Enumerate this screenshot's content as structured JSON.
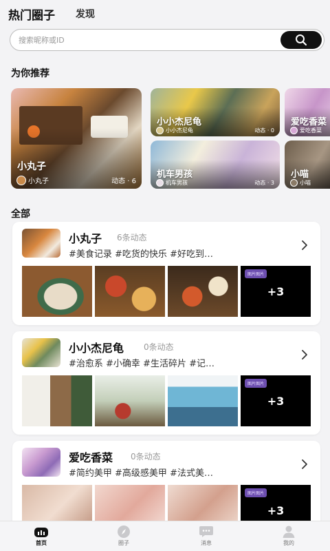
{
  "header": {
    "tab_active": "热门圈子",
    "tab_discover": "发现"
  },
  "search": {
    "placeholder": "搜索昵称或ID"
  },
  "recommend": {
    "title": "为你推荐",
    "cards": [
      {
        "name": "小丸子",
        "author": "小丸子",
        "count": "动态 · 6"
      },
      {
        "name": "小小杰尼龟",
        "author": "小小杰尼龟",
        "count": "动态 · 0"
      },
      {
        "name": "机车男孩",
        "author": "机车男孩",
        "count": "动态 · 3"
      },
      {
        "name": "爱吃香菜",
        "author": "爱吃香菜"
      },
      {
        "name": "小喵",
        "author": "小喵"
      }
    ]
  },
  "all": {
    "title": "全部",
    "circles": [
      {
        "name": "小丸子",
        "count": "6条动态",
        "tags": "#美食记录 #吃货的快乐 #好吃到…",
        "more": "+3",
        "badge": "图片图片"
      },
      {
        "name": "小小杰尼龟",
        "count": "0条动态",
        "tags": "#治愈系 #小确幸 #生活碎片 #记…",
        "more": "+3",
        "badge": "图片图片"
      },
      {
        "name": "爱吃香菜",
        "count": "0条动态",
        "tags": "#简约美甲 #高级感美甲 #法式美…",
        "more": "+3",
        "badge": "图片图片"
      }
    ]
  },
  "tabbar": {
    "home": "首页",
    "circle": "圈子",
    "message": "消息",
    "mine": "我的"
  },
  "icons": {
    "search": "search-icon",
    "arrow": "chevron-right-icon",
    "home": "home-icon",
    "circle": "compass-icon",
    "message": "chat-icon",
    "mine": "user-icon"
  }
}
